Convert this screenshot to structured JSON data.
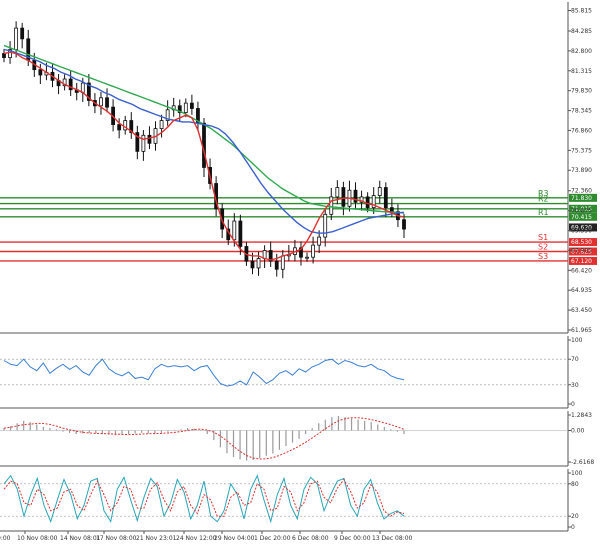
{
  "chart_data": [
    {
      "type": "candlestick",
      "panel": "price",
      "ylim": [
        61.965,
        86.3
      ],
      "y_ticks": [
        "85.815",
        "84.285",
        "82.800",
        "81.315",
        "79.830",
        "78.345",
        "76.860",
        "75.375",
        "73.890",
        "72.360",
        "70.875",
        "69.390",
        "67.905",
        "66.420",
        "64.935",
        "63.450",
        "61.965"
      ],
      "x_ticks": [
        "10 Nov 08:00",
        "14 Nov 08:01",
        "17 Nov 08:00",
        "21 Nov 23:01",
        "24 Nov 12:00",
        "29 Nov 04:00",
        "1 Dec 20:00",
        "6 Dec 08:00",
        "9 Dec 00:00",
        "13 Dec 08:00"
      ],
      "first_x_tick_partial": "0:00",
      "close_series": [
        82.3,
        82.9,
        84.5,
        83.7,
        82.1,
        81.4,
        81.0,
        81.2,
        80.6,
        80.2,
        80.7,
        79.9,
        79.7,
        80.4,
        79.1,
        78.7,
        79.3,
        78.6,
        77.3,
        76.9,
        77.6,
        76.7,
        75.3,
        76.5,
        75.9,
        77.0,
        77.6,
        78.4,
        78.7,
        78.2,
        78.9,
        78.5,
        77.4,
        74.1,
        72.9,
        71.0,
        69.5,
        68.7,
        70.1,
        68.2,
        67.1,
        66.6,
        67.3,
        67.9,
        67.1,
        66.5,
        67.5,
        67.6,
        68.1,
        67.4,
        67.4,
        68.3,
        68.9,
        70.6,
        71.9,
        72.6,
        71.2,
        72.4,
        71.5,
        71.9,
        71.1,
        72.0,
        72.6,
        71.1,
        70.8,
        70.2,
        69.5
      ],
      "sma_short": [
        82.6,
        82.7,
        82.6,
        82.3,
        82.1,
        81.8,
        81.5,
        81.2,
        80.9,
        80.6,
        80.3,
        80.1,
        79.9,
        79.7,
        79.3,
        78.9,
        78.6,
        78.3,
        77.9,
        77.4,
        77.1,
        76.8,
        76.4,
        76.2,
        76.3,
        76.4,
        76.7,
        77.1,
        77.6,
        77.8,
        78.0,
        77.8,
        76.9,
        75.3,
        73.4,
        71.6,
        70.1,
        69.3,
        68.6,
        68.0,
        67.6,
        67.5,
        67.5,
        67.3,
        67.2,
        67.3,
        67.5,
        67.6,
        67.8,
        68.0,
        68.6,
        69.4,
        70.3,
        71.0,
        71.6,
        71.7,
        71.8,
        71.8,
        71.7,
        71.6,
        71.4,
        71.3,
        71.1,
        70.9,
        70.7,
        70.5,
        70.4
      ],
      "sma_mid": [
        82.9,
        82.8,
        82.6,
        82.4,
        82.2,
        82.0,
        81.7,
        81.5,
        81.2,
        81.0,
        80.7,
        80.5,
        80.2,
        80.0,
        79.7,
        79.5,
        79.2,
        79.0,
        78.8,
        78.5,
        78.3,
        78.1,
        77.9,
        77.7,
        77.6,
        77.5,
        77.5,
        77.4,
        77.3,
        77.2,
        77.0,
        76.6,
        76.0,
        75.3,
        74.5,
        73.7,
        72.9,
        72.2,
        71.6,
        71.0,
        70.5,
        70.0,
        69.6,
        69.3,
        69.2,
        69.2,
        69.3,
        69.5,
        69.7,
        69.9,
        70.1,
        70.3,
        70.4,
        70.5,
        70.6,
        70.7,
        70.75
      ],
      "sma_long": [
        83.2,
        83.0,
        82.8,
        82.6,
        82.4,
        82.2,
        82.0,
        81.8,
        81.6,
        81.4,
        81.2,
        81.0,
        80.8,
        80.6,
        80.4,
        80.2,
        80.0,
        79.8,
        79.6,
        79.4,
        79.2,
        79.0,
        78.8,
        78.6,
        78.4,
        78.2,
        77.9,
        77.6,
        77.3,
        77.0,
        76.6,
        76.2,
        75.8,
        75.3,
        74.8,
        74.3,
        73.8,
        73.3,
        72.9,
        72.5,
        72.2,
        71.9,
        71.6,
        71.4,
        71.3,
        71.2,
        71.15,
        71.1,
        71.05,
        71.0,
        70.95,
        70.9,
        70.85,
        70.8,
        70.77,
        70.75,
        70.7
      ],
      "levels": [
        {
          "label": "R3",
          "value": "71.830",
          "kind": "resistance",
          "color": "#2e8b2e"
        },
        {
          "label": "",
          "value": "71.015",
          "kind": "pivot",
          "color": "#2e8b2e"
        },
        {
          "label": "R2",
          "value": "",
          "kind": "resistance",
          "color": "#2e8b2e"
        },
        {
          "label": "R1",
          "value": "70.415",
          "kind": "resistance",
          "color": "#2e8b2e"
        },
        {
          "label": "",
          "value": "69.620",
          "kind": "price",
          "color": "#222222"
        },
        {
          "label": "S1",
          "value": "68.530",
          "kind": "support",
          "color": "#e03030"
        },
        {
          "label": "S2",
          "value": "67.825",
          "kind": "support",
          "color": "#e03030"
        },
        {
          "label": "S3",
          "value": "67.120",
          "kind": "support",
          "color": "#e03030"
        }
      ],
      "current_price": "69.620"
    },
    {
      "type": "line",
      "panel": "rsi",
      "ylim": [
        0,
        100
      ],
      "y_ticks": [
        "100",
        "70",
        "30",
        "0"
      ],
      "series": [
        {
          "values": [
            68,
            62,
            60,
            70,
            58,
            52,
            64,
            48,
            56,
            62,
            54,
            60,
            50,
            45,
            60,
            70,
            55,
            48,
            44,
            50,
            40,
            42,
            38,
            55,
            62,
            58,
            60,
            58,
            60,
            52,
            58,
            60,
            45,
            32,
            28,
            30,
            36,
            30,
            50,
            42,
            32,
            38,
            48,
            52,
            45,
            55,
            50,
            58,
            62,
            68,
            70,
            62,
            68,
            65,
            60,
            58,
            62,
            55,
            52,
            44,
            40,
            38
          ]
        }
      ],
      "colors": {
        "line": "#3a7fd5"
      }
    },
    {
      "type": "histogram",
      "panel": "macd",
      "y_ticks": [
        "1.2843",
        "0.00",
        "-2.6168"
      ],
      "series": [
        {
          "values": [
            0.2,
            0.35,
            0.6,
            0.8,
            0.7,
            0.5,
            0.3,
            0.2,
            0.1,
            -0.1,
            -0.2,
            -0.3,
            -0.25,
            -0.2,
            -0.25,
            -0.3,
            -0.35,
            -0.4,
            -0.35,
            -0.3,
            -0.25,
            -0.2,
            -0.25,
            -0.3,
            -0.2,
            -0.1,
            0.05,
            0.1,
            0.2,
            0.15,
            0.05,
            -0.3,
            -0.8,
            -1.4,
            -1.9,
            -2.2,
            -2.4,
            -2.5,
            -2.45,
            -2.3,
            -2.1,
            -1.9,
            -1.6,
            -1.3,
            -1.0,
            -0.7,
            -0.3,
            0.2,
            0.6,
            0.9,
            1.1,
            1.2,
            1.1,
            1.0,
            0.9,
            0.8,
            0.7,
            0.5,
            0.3,
            0.1,
            -0.1,
            -0.3
          ]
        }
      ],
      "colors": {
        "bars": "#9a9a9a",
        "signal": "#e03030"
      }
    },
    {
      "type": "line",
      "panel": "stochastic",
      "ylim": [
        0,
        100
      ],
      "y_ticks": [
        "100",
        "80",
        "20",
        "0"
      ],
      "series": [
        {
          "name": "",
          "values": [
            80,
            95,
            70,
            20,
            60,
            90,
            40,
            10,
            50,
            88,
            60,
            15,
            40,
            85,
            90,
            30,
            10,
            70,
            92,
            50,
            12,
            55,
            90,
            75,
            20,
            45,
            88,
            65,
            15,
            40,
            85,
            20,
            10,
            30,
            80,
            60,
            15,
            70,
            95,
            50,
            10,
            60,
            90,
            40,
            15,
            70,
            92,
            80,
            30,
            60,
            85,
            90,
            40,
            20,
            70,
            88,
            45,
            15,
            25,
            30,
            20
          ]
        },
        {
          "name": "",
          "values": [
            70,
            85,
            80,
            45,
            40,
            70,
            60,
            30,
            35,
            65,
            70,
            40,
            30,
            60,
            85,
            60,
            30,
            45,
            75,
            70,
            35,
            35,
            70,
            82,
            50,
            30,
            65,
            75,
            40,
            25,
            60,
            50,
            20,
            20,
            55,
            65,
            40,
            45,
            80,
            70,
            30,
            35,
            75,
            65,
            30,
            45,
            80,
            85,
            55,
            45,
            72,
            88,
            65,
            35,
            45,
            78,
            65,
            30,
            20,
            28,
            25
          ]
        }
      ],
      "colors": {
        "k": "#2aa6b8",
        "d": "#e03030"
      }
    }
  ]
}
